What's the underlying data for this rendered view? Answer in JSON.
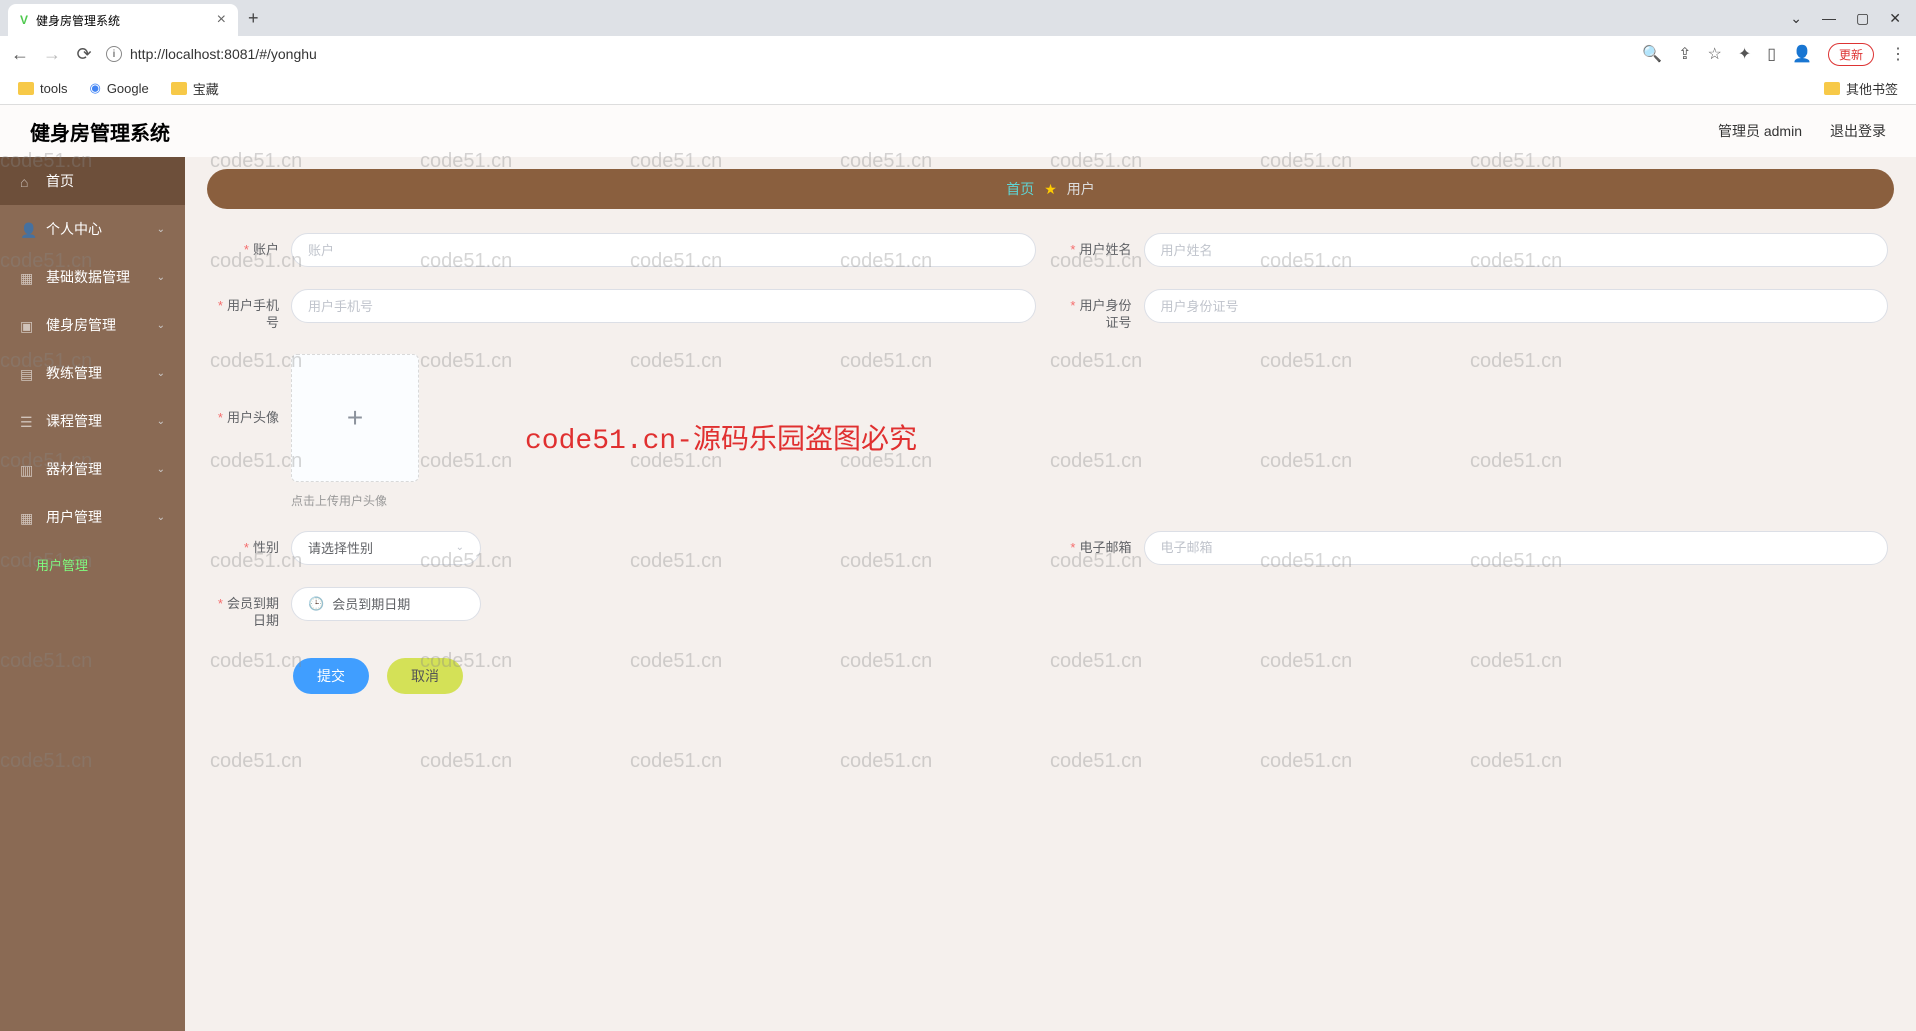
{
  "browser": {
    "tab_title": "健身房管理系统",
    "url": "http://localhost:8081/#/yonghu",
    "update_btn": "更新",
    "bookmarks": {
      "tools": "tools",
      "google": "Google",
      "baozang": "宝藏",
      "other": "其他书签"
    }
  },
  "header": {
    "app_title": "健身房管理系统",
    "admin_label": "管理员 admin",
    "logout": "退出登录"
  },
  "sidebar": {
    "items": [
      {
        "label": "首页"
      },
      {
        "label": "个人中心"
      },
      {
        "label": "基础数据管理"
      },
      {
        "label": "健身房管理"
      },
      {
        "label": "教练管理"
      },
      {
        "label": "课程管理"
      },
      {
        "label": "器材管理"
      },
      {
        "label": "用户管理"
      }
    ],
    "sub_item": "用户管理"
  },
  "breadcrumb": {
    "home": "首页",
    "star": "★",
    "current": "用户"
  },
  "form": {
    "account_label": "账户",
    "account_ph": "账户",
    "username_label": "用户姓名",
    "username_ph": "用户姓名",
    "phone_label": "用户手机号",
    "phone_ph": "用户手机号",
    "idcard_label": "用户身份证号",
    "idcard_ph": "用户身份证号",
    "avatar_label": "用户头像",
    "avatar_hint": "点击上传用户头像",
    "gender_label": "性别",
    "gender_ph": "请选择性别",
    "email_label": "电子邮箱",
    "email_ph": "电子邮箱",
    "expire_label": "会员到期日期",
    "expire_ph": "会员到期日期",
    "submit": "提交",
    "cancel": "取消"
  },
  "watermark": "code51.cn-源码乐园盗图必究",
  "wm_text": "code51.cn"
}
